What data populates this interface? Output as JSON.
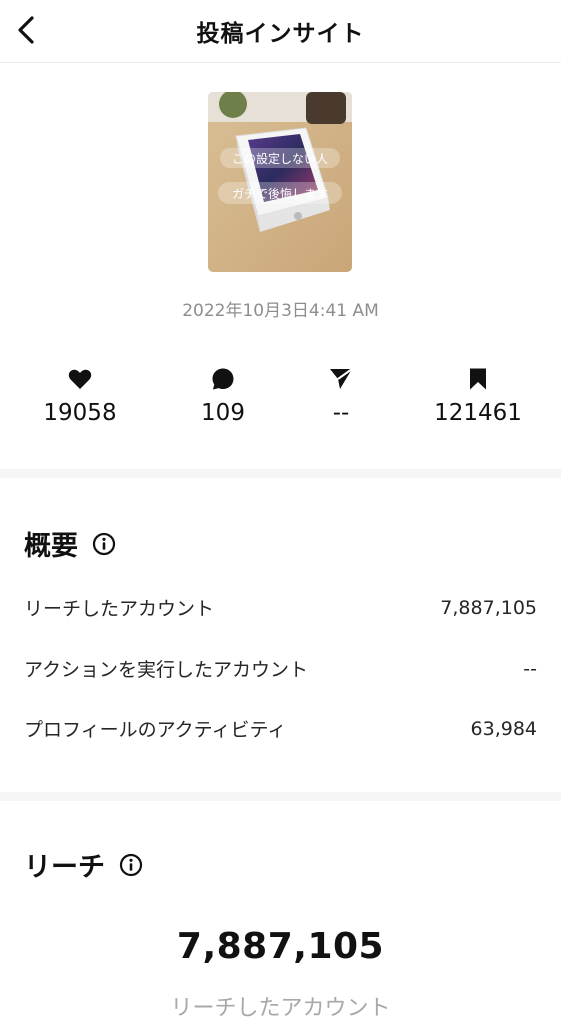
{
  "header": {
    "title": "投稿インサイト"
  },
  "post": {
    "thumbnail_caption_line1": "この設定しない人",
    "thumbnail_caption_line2": "ガチで後悔します",
    "date": "2022年10月3日4:41 AM"
  },
  "stats": [
    {
      "icon": "heart-icon",
      "value": "19058"
    },
    {
      "icon": "comment-icon",
      "value": "109"
    },
    {
      "icon": "share-icon",
      "value": "--"
    },
    {
      "icon": "bookmark-icon",
      "value": "121461"
    }
  ],
  "overview": {
    "title": "概要",
    "rows": [
      {
        "label": "リーチしたアカウント",
        "value": "7,887,105"
      },
      {
        "label": "アクションを実行したアカウント",
        "value": "--"
      },
      {
        "label": "プロフィールのアクティビティ",
        "value": "63,984"
      }
    ]
  },
  "reach": {
    "title": "リーチ",
    "total": "7,887,105",
    "caption": "リーチしたアカウント"
  },
  "colors": {
    "text": "#111111",
    "secondary": "#8e8e8e",
    "divider": "#f5f5f5"
  }
}
